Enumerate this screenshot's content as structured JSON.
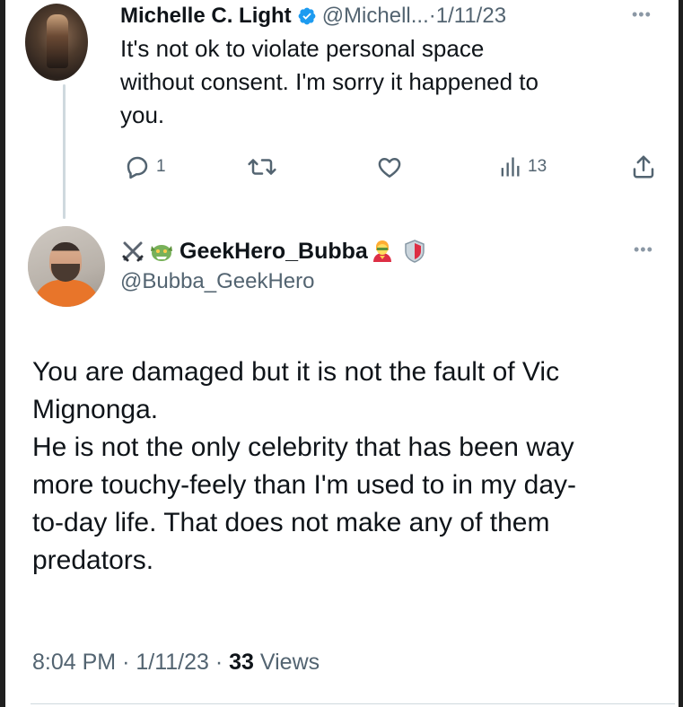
{
  "reply": {
    "display_name": "Michelle C. Light",
    "handle": "@Michell...",
    "separator": "·",
    "date": "1/11/23",
    "more_label": "•••",
    "text": "It's not ok to violate personal space\nwithout consent. I'm sorry it happened to\nyou.",
    "actions": {
      "reply_count": "1",
      "retweet_count": "",
      "like_count": "",
      "views_count": "13"
    },
    "icons": [
      "verified-badge-icon",
      "reply-icon",
      "retweet-icon",
      "like-icon",
      "views-icon",
      "share-icon"
    ]
  },
  "tweet": {
    "display_name": "GeekHero_Bubba",
    "name_emojis": [
      "crossed-swords-icon",
      "dragon-icon",
      "superhero-icon",
      "shield-icon"
    ],
    "handle": "@Bubba_GeekHero",
    "more_label": "•••",
    "text": "You are damaged but it is not the fault of Vic\nMignonga.\nHe is not the only celebrity that has been way\nmore touchy-feely than I'm used to in my day-\nto-day life. That does not make any of them\npredators.",
    "time": "8:04 PM",
    "separator": "·",
    "date": "1/11/23",
    "views_count": "33",
    "views_label": "Views"
  },
  "colors": {
    "background": "#ffffff",
    "text_primary": "#0f1419",
    "text_secondary": "#536471",
    "verified_blue": "#1d9bf0",
    "thread_line": "#cfd9de"
  }
}
